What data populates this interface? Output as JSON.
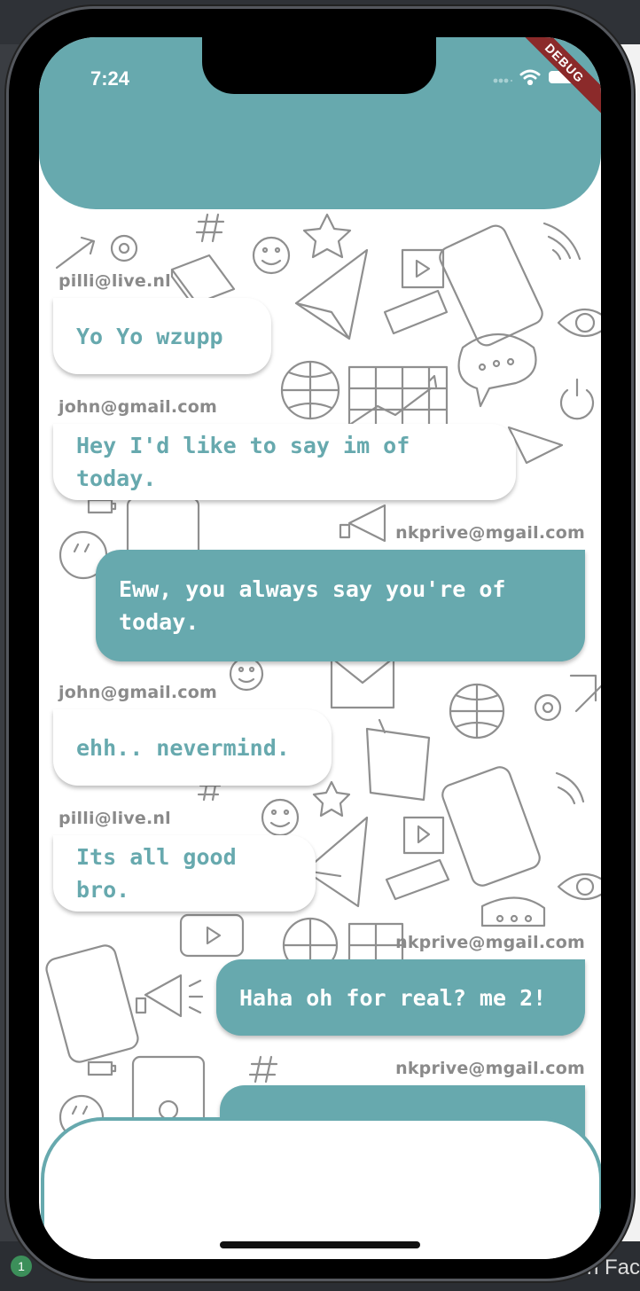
{
  "status_bar": {
    "time": "7:24",
    "debug_label": "DEBUG"
  },
  "messages": [
    {
      "sender": "pilli@live.nl",
      "text": "Yo Yo wzupp",
      "direction": "in"
    },
    {
      "sender": "john@gmail.com",
      "text": "Hey I'd like to say im of today.",
      "direction": "in"
    },
    {
      "sender": "nkprive@mgail.com",
      "text": "Eww, you always say you're of today.",
      "direction": "out"
    },
    {
      "sender": "john@gmail.com",
      "text": "ehh.. nevermind.",
      "direction": "in"
    },
    {
      "sender": "pilli@live.nl",
      "text": "Its all good bro.",
      "direction": "in"
    },
    {
      "sender": "nkprive@mgail.com",
      "text": "Haha oh for real? me 2!",
      "direction": "out"
    },
    {
      "sender": "nkprive@mgail.com",
      "text": "",
      "direction": "out"
    }
  ],
  "colors": {
    "accent": "#67a9ae",
    "bubble_in_bg": "#ffffff",
    "sender_text": "#8a8a8a"
  },
  "desktop": {
    "taskbar_badge": "1",
    "taskbar_text": "n Fac"
  }
}
